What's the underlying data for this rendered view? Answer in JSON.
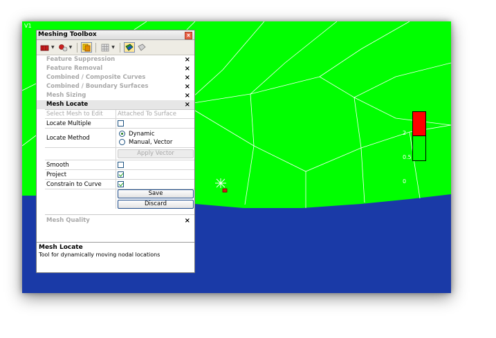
{
  "viewport": {
    "label": "V1",
    "colors": {
      "mesh_fill": "#00ff00",
      "background": "#1a3aa7",
      "mesh_lines": "#ffffff"
    }
  },
  "legend": {
    "labels": [
      "2",
      "0.5",
      "0"
    ],
    "colors": {
      "high": "#ff0000",
      "low": "#00ff00"
    }
  },
  "toolbox": {
    "title": "Meshing Toolbox",
    "close_icon": "close-icon",
    "toolbar": {
      "icons": [
        "mesh-red-icon",
        "mesh-split-icon",
        "mesh-copy-icon",
        "grid-icon",
        "mesh-active-icon",
        "mesh-gray-icon"
      ]
    },
    "sections": [
      {
        "label": "Feature Suppression",
        "active": false
      },
      {
        "label": "Feature Removal",
        "active": false
      },
      {
        "label": "Combined / Composite Curves",
        "active": false
      },
      {
        "label": "Combined / Boundary Surfaces",
        "active": false
      },
      {
        "label": "Mesh Sizing",
        "active": false
      },
      {
        "label": "Mesh Locate",
        "active": true
      }
    ],
    "close_glyph": "×",
    "mesh_locate": {
      "select_mesh_label": "Select Mesh to Edit",
      "select_mesh_value": "Attached To Surface",
      "locate_multiple_label": "Locate Multiple",
      "locate_multiple_checked": false,
      "locate_method_label": "Locate Method",
      "method_options": [
        {
          "label": "Dynamic",
          "selected": true
        },
        {
          "label": "Manual, Vector",
          "selected": false
        }
      ],
      "apply_vector_label": "Apply Vector",
      "smooth_label": "Smooth",
      "smooth_checked": false,
      "project_label": "Project",
      "project_checked": true,
      "constrain_label": "Constrain to Curve",
      "constrain_checked": true,
      "save_label": "Save",
      "discard_label": "Discard"
    },
    "mesh_quality": {
      "label": "Mesh Quality"
    },
    "description": {
      "title": "Mesh Locate",
      "text": "Tool for dynamically moving nodal locations"
    }
  }
}
